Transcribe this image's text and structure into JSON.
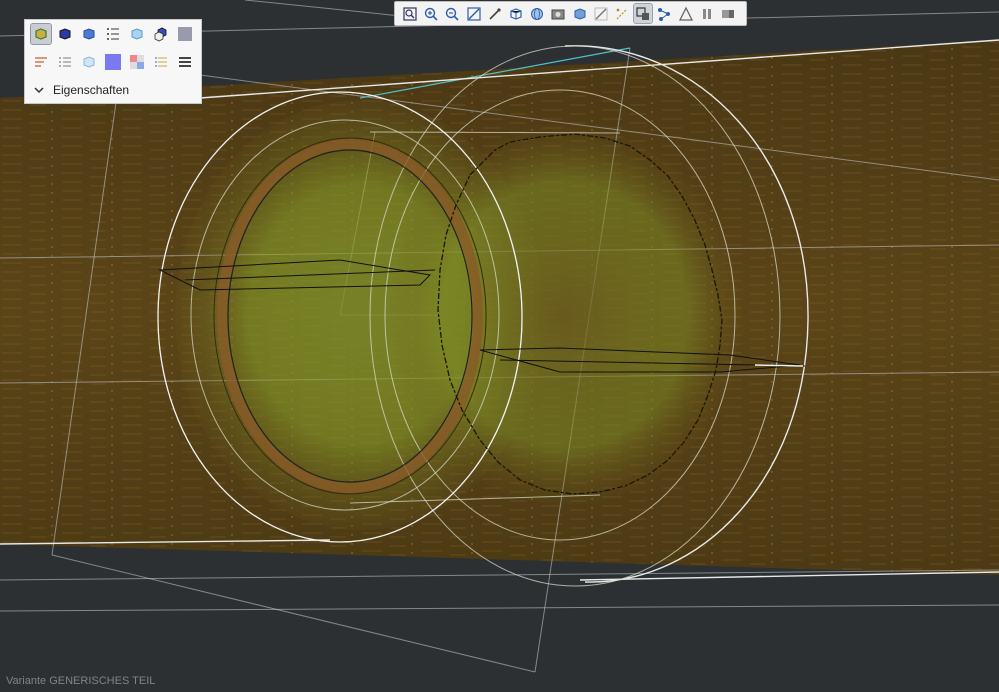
{
  "toolbar": {
    "icons": [
      "zoom-fit-icon",
      "zoom-in-icon",
      "zoom-out-icon",
      "zoom-window-icon",
      "pan-icon",
      "view-cube-icon",
      "view-globe-icon",
      "render-mode-icon",
      "shade-icon",
      "section-icon",
      "measure-icon",
      "display-options-icon",
      "graph-icon",
      "triangle-mesh-icon",
      "pause-icon",
      "stop-icon"
    ],
    "active_index": 11
  },
  "panel": {
    "row1_icons": [
      "shaded-color-icon",
      "solid-cube-icon",
      "cube-blue-icon",
      "list-tree-icon",
      "transparent-cube-icon",
      "assembly-icon",
      "gray-swatch-icon"
    ],
    "row2_icons": [
      "sort-lines-icon",
      "checklist-icon",
      "light-cube-icon",
      "blue-swatch-icon",
      "checker-icon",
      "filter-list-icon",
      "menu-lines-icon"
    ],
    "properties_label": "Eigenschaften"
  },
  "status": {
    "variant_text": "Variante GENERISCHES TEIL"
  },
  "colors": {
    "background": "#2c3033",
    "body_brown": "#5a4418",
    "glow_green": "#8aa52a",
    "edge_white": "#e8e8e8",
    "accent_cyan": "#4fc0c8"
  }
}
